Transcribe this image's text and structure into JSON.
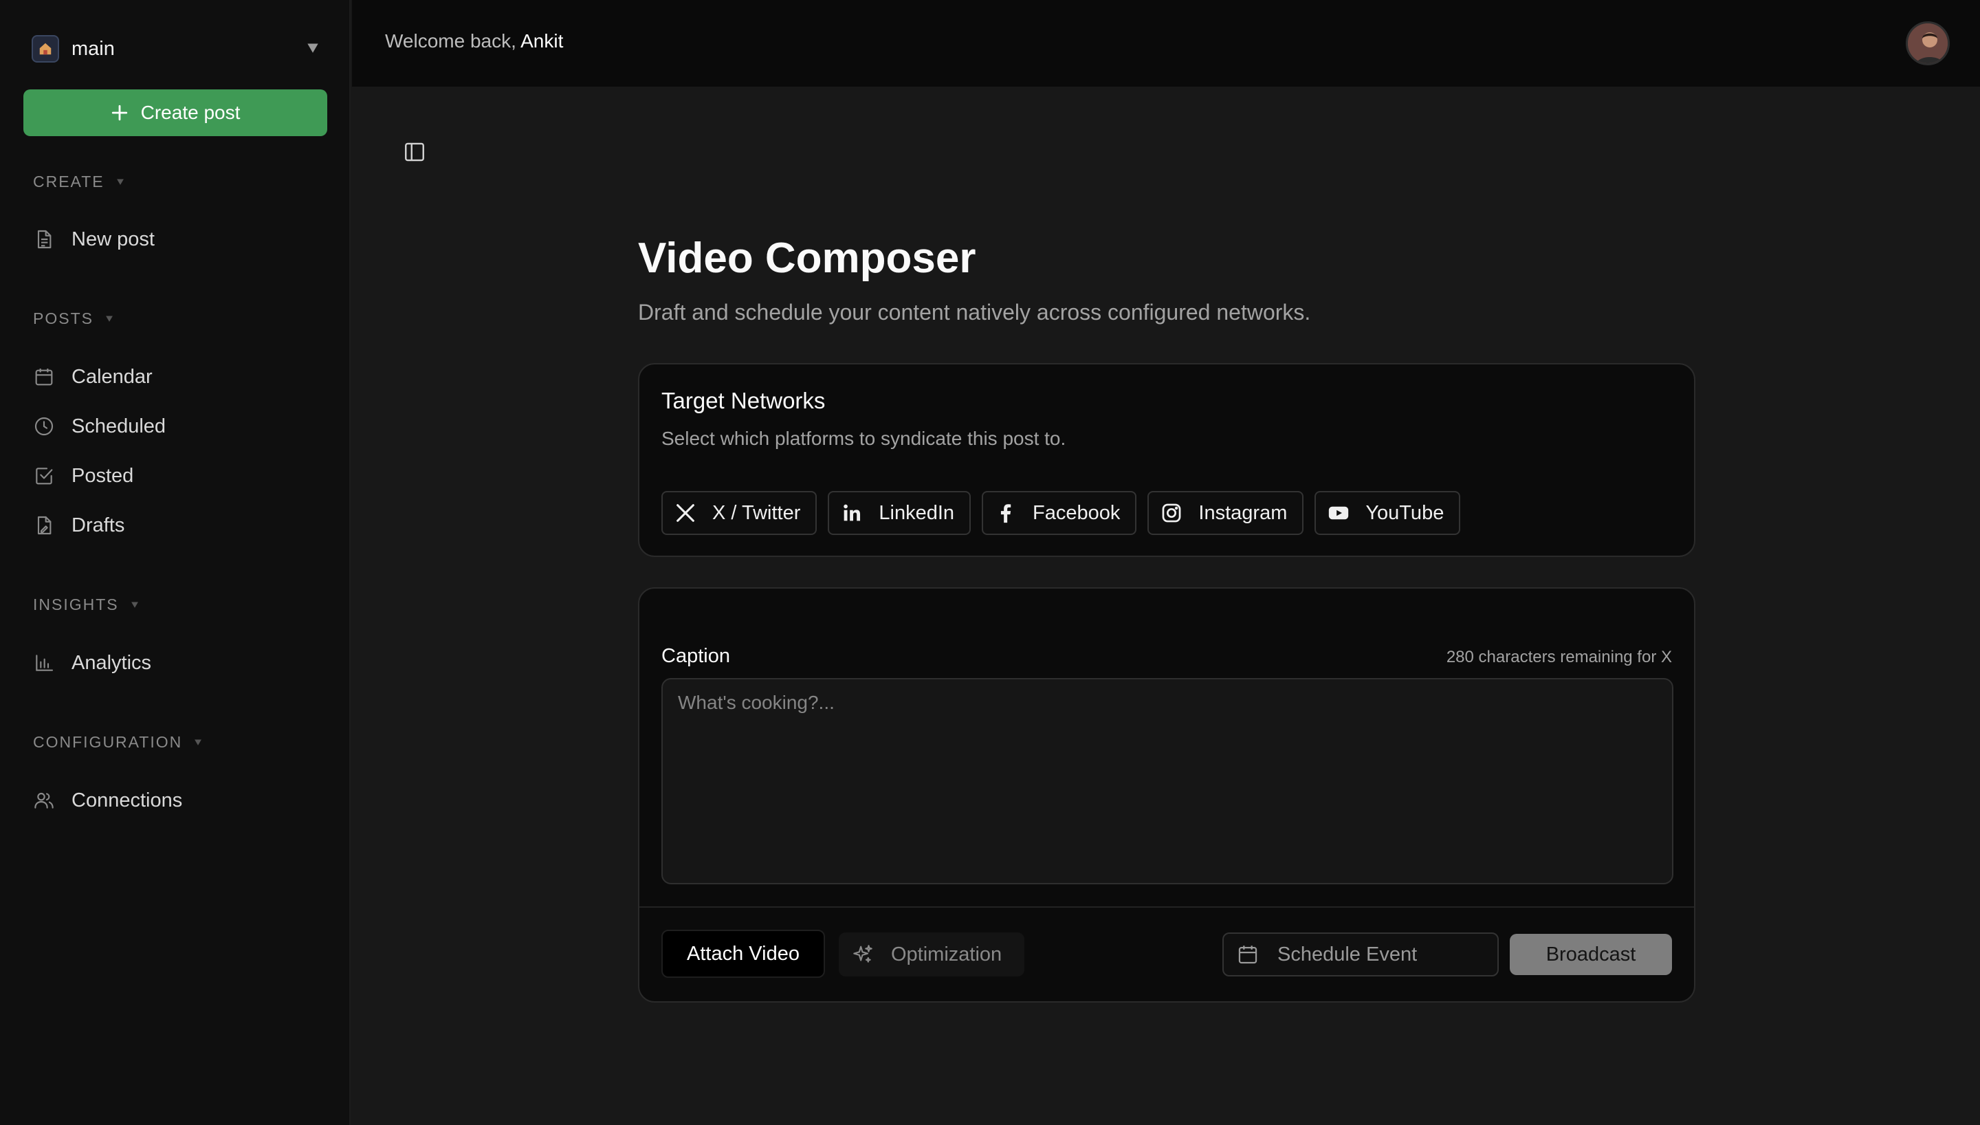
{
  "sidebar": {
    "workspace": {
      "name": "main"
    },
    "create_button": "Create post",
    "sections": [
      {
        "title": "CREATE",
        "items": [
          {
            "label": "New post",
            "icon": "file-text-icon"
          }
        ]
      },
      {
        "title": "POSTS",
        "items": [
          {
            "label": "Calendar",
            "icon": "calendar-icon"
          },
          {
            "label": "Scheduled",
            "icon": "clock-icon"
          },
          {
            "label": "Posted",
            "icon": "check-square-icon"
          },
          {
            "label": "Drafts",
            "icon": "file-draft-icon"
          }
        ]
      },
      {
        "title": "INSIGHTS",
        "items": [
          {
            "label": "Analytics",
            "icon": "bar-chart-icon"
          }
        ]
      },
      {
        "title": "CONFIGURATION",
        "items": [
          {
            "label": "Connections",
            "icon": "users-icon"
          }
        ]
      }
    ]
  },
  "header": {
    "welcome_prefix": "Welcome back, ",
    "user_name": "Ankit"
  },
  "main": {
    "title": "Video Composer",
    "subtitle": "Draft and schedule your content natively across configured networks.",
    "networks_card": {
      "title": "Target Networks",
      "description": "Select which platforms to syndicate this post to.",
      "networks": [
        {
          "label": "X / Twitter",
          "icon": "x-twitter-icon"
        },
        {
          "label": "LinkedIn",
          "icon": "linkedin-icon"
        },
        {
          "label": "Facebook",
          "icon": "facebook-icon"
        },
        {
          "label": "Instagram",
          "icon": "instagram-icon"
        },
        {
          "label": "YouTube",
          "icon": "youtube-icon"
        }
      ]
    },
    "compose_card": {
      "caption_label": "Caption",
      "char_count": "280 characters remaining for X",
      "caption_value": "",
      "caption_placeholder": "What's cooking?...",
      "attach_label": "Attach Video",
      "optimization_label": "Optimization",
      "schedule_label": "Schedule Event",
      "broadcast_label": "Broadcast"
    }
  },
  "colors": {
    "accent_green": "#3f9a55",
    "background": "#181818",
    "sidebar_bg": "#0f0f0f",
    "broadcast_disabled": "#7e7e7e"
  }
}
